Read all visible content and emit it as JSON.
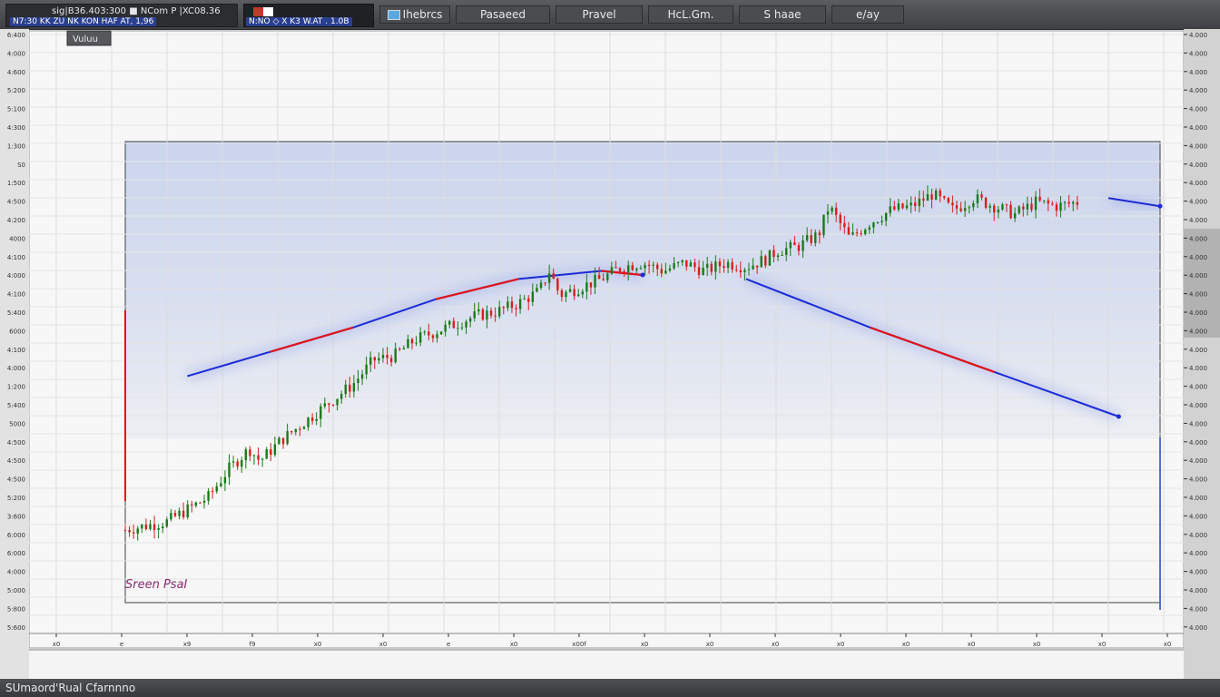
{
  "header": {
    "ticker_line1": "sig|B36.403:300 ■ NCom P |XC08.36",
    "ticker_line2": "N7:30 KK ZU NK KON HAF AT, 1,96",
    "ticker2_line2": "N:NO ◇ X K3 W.AT . 1.0B",
    "tabs": [
      {
        "label": "Ihebrcs"
      },
      {
        "label": "Pasaeed"
      },
      {
        "label": "Pravel"
      },
      {
        "label": "HcL.Gm."
      },
      {
        "label": "S haae"
      },
      {
        "label": "e/ay"
      }
    ]
  },
  "panel": {
    "tab_label": "Vuluu",
    "annotation": "Sreen PsaI"
  },
  "footer": {
    "status": "SUmaord'Rual Cfarnnno"
  },
  "colors": {
    "up": "#1a7a1a",
    "down": "#d41f1f",
    "trend_blue": "#1c2bd6",
    "trend_red": "#e0141a",
    "band": "#c9d3ea"
  },
  "chart_data": {
    "type": "candlestick",
    "title": "",
    "xlabel": "",
    "ylabel": "",
    "ylim": [
      0,
      100
    ],
    "y_tick_labels_left": [
      "6:400",
      "4:000",
      "4:600",
      "5:200",
      "5:100",
      "4:300",
      "1:300",
      "S0",
      "1:500",
      "4:500",
      "4:200",
      "4000",
      "4:100",
      "4:000",
      "4:100",
      "5:400",
      "6000",
      "4:100",
      "4:000",
      "1:200",
      "5:400",
      "5000",
      "4:500",
      "4:500",
      "4:500",
      "5:200",
      "3:600",
      "6:000",
      "6:000",
      "4:000",
      "5:000",
      "5:800",
      "5:600"
    ],
    "y_tick_labels_right": [
      "4.000",
      "4.000",
      "4.000",
      "4.000",
      "4.000",
      "4.000",
      "4.000",
      "4.000",
      "4.000",
      "4.000",
      "4.000",
      "4.000",
      "4.000",
      "4.000",
      "4.000",
      "4.000",
      "4.000",
      "4.000",
      "4.000",
      "4.000",
      "4.000",
      "4.000",
      "4.000",
      "4.000",
      "4.000",
      "4.000",
      "4.000",
      "4.000",
      "4.000",
      "4.000",
      "4.000",
      "4.000",
      "4.000"
    ],
    "x_tick_labels": [
      "x0",
      "e",
      "x9",
      "f9",
      "x0",
      "x0",
      "e",
      "x0",
      "x00f",
      "x0",
      "x0",
      "x0",
      "x0",
      "x0",
      "x0",
      "x0",
      "x0",
      "x0"
    ],
    "price_path": [
      [
        0,
        18
      ],
      [
        4,
        20
      ],
      [
        8,
        26
      ],
      [
        10,
        33
      ],
      [
        12,
        38
      ],
      [
        13,
        35
      ],
      [
        15,
        40
      ],
      [
        18,
        46
      ],
      [
        20,
        50
      ],
      [
        22,
        54
      ],
      [
        24,
        60
      ],
      [
        26,
        61
      ],
      [
        28,
        65
      ],
      [
        30,
        67
      ],
      [
        32,
        69
      ],
      [
        34,
        71
      ],
      [
        36,
        72
      ],
      [
        38,
        74
      ],
      [
        40,
        77
      ],
      [
        41,
        82
      ],
      [
        42,
        76
      ],
      [
        44,
        78
      ],
      [
        46,
        80
      ],
      [
        48,
        83
      ],
      [
        50,
        84
      ],
      [
        52,
        82
      ],
      [
        54,
        84
      ],
      [
        56,
        82
      ],
      [
        58,
        84
      ],
      [
        60,
        83
      ],
      [
        62,
        85
      ],
      [
        63,
        87
      ],
      [
        65,
        88
      ],
      [
        67,
        91
      ],
      [
        68,
        98
      ],
      [
        70,
        90
      ],
      [
        72,
        94
      ],
      [
        74,
        97
      ],
      [
        76,
        98
      ],
      [
        78,
        101
      ],
      [
        80,
        97
      ],
      [
        82,
        100
      ],
      [
        84,
        98
      ],
      [
        86,
        96
      ],
      [
        88,
        99
      ],
      [
        90,
        98
      ],
      [
        92,
        99
      ]
    ],
    "trendlines": [
      {
        "points": [
          [
            6,
            56
          ],
          [
            14,
            62
          ],
          [
            22,
            68
          ],
          [
            30,
            75
          ],
          [
            38,
            80
          ],
          [
            46,
            82
          ],
          [
            50,
            81
          ]
        ],
        "color": "blue-red"
      },
      {
        "points": [
          [
            60,
            80
          ],
          [
            72,
            68
          ],
          [
            84,
            57
          ],
          [
            96,
            46
          ]
        ],
        "color": "blue-red"
      },
      {
        "points": [
          [
            95,
            100
          ],
          [
            100,
            98
          ]
        ],
        "color": "blue"
      }
    ],
    "grid": true,
    "legend": "none"
  }
}
